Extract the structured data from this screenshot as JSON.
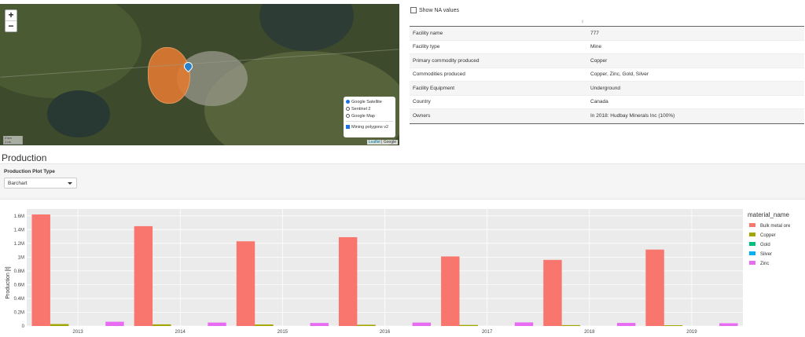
{
  "map": {
    "zoom_in": "+",
    "zoom_out": "−",
    "layers": [
      {
        "label": "Google Satellite",
        "selected": true
      },
      {
        "label": "Sentinel 2",
        "selected": false
      },
      {
        "label": "Google Map",
        "selected": false
      }
    ],
    "overlay": {
      "label": "Mining polygons v2",
      "checked": true
    },
    "attribution": {
      "leaflet": "Leaflet",
      "sep": " | ",
      "provider": "Google"
    },
    "scale": {
      "km": "2 km",
      "mi": "1 mi"
    }
  },
  "facility": {
    "show_na_label": "Show NA values",
    "sort_icon": "⇕",
    "rows": [
      {
        "key": "Facility name",
        "value": "777"
      },
      {
        "key": "Facility type",
        "value": "Mine"
      },
      {
        "key": "Primary commodity produced",
        "value": "Copper"
      },
      {
        "key": "Commodities produced",
        "value": "Copper, Zinc, Gold, Silver"
      },
      {
        "key": "Facility Equipment",
        "value": "Underground"
      },
      {
        "key": "Country",
        "value": "Canada"
      },
      {
        "key": "Owners",
        "value": "In 2018: Hudbay Minerals Inc (100%)"
      }
    ]
  },
  "production": {
    "heading": "Production",
    "plot_type_label": "Production Plot Type",
    "plot_type_value": "Barchart"
  },
  "chart_data": {
    "type": "bar",
    "categories": [
      "2013",
      "2014",
      "2015",
      "2016",
      "2017",
      "2018",
      "2019"
    ],
    "series": [
      {
        "name": "Bulk metal ore",
        "color": "#F8766D",
        "values": [
          1620000,
          1450000,
          1230000,
          1290000,
          1010000,
          960000,
          1110000
        ]
      },
      {
        "name": "Copper",
        "color": "#A3A500",
        "values": [
          28000,
          24000,
          22000,
          18000,
          15000,
          13000,
          11000
        ]
      },
      {
        "name": "Gold",
        "color": "#00BF7D",
        "values": [
          2,
          2,
          2,
          2,
          2,
          2,
          2
        ]
      },
      {
        "name": "Silver",
        "color": "#00B0F6",
        "values": [
          20,
          20,
          20,
          20,
          20,
          20,
          20
        ]
      },
      {
        "name": "Zinc",
        "color": "#E76BF3",
        "values": [
          62000,
          50000,
          44000,
          50000,
          52000,
          45000,
          40000
        ]
      }
    ],
    "ylabel": "Production [t]",
    "ylim": [
      0,
      1700000
    ],
    "yticks": [
      0,
      200000,
      400000,
      600000,
      800000,
      1000000,
      1200000,
      1400000,
      1600000
    ],
    "ytick_labels": [
      "0",
      "0.2M",
      "0.4M",
      "0.6M",
      "0.8M",
      "1M",
      "1.2M",
      "1.4M",
      "1.6M"
    ],
    "legend_title": "material_name",
    "legend_position": "right",
    "grid": true
  }
}
